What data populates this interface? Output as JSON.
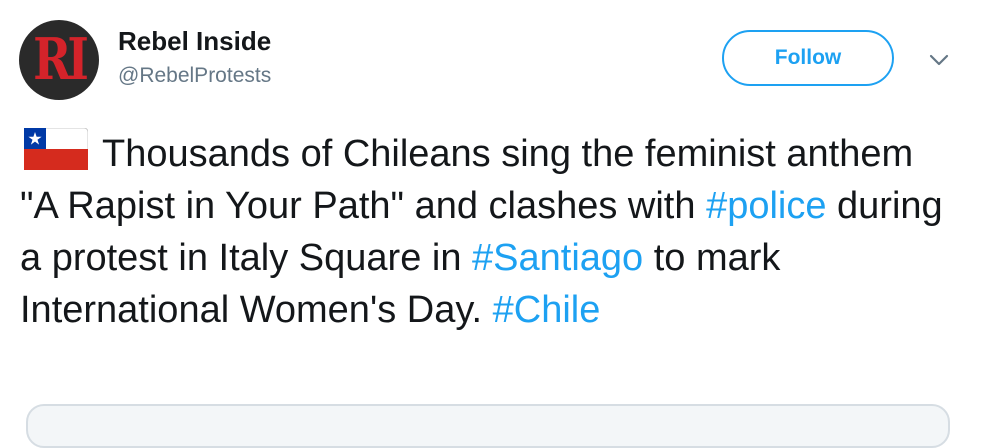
{
  "author": {
    "avatar_logo": "RI",
    "display_name": "Rebel Inside",
    "handle": "@RebelProtests"
  },
  "actions": {
    "follow_label": "Follow",
    "menu_icon": "chevron-down-icon"
  },
  "tweet": {
    "flag_icon": "chile-flag-icon",
    "segments": {
      "s1": "Thousands of Chileans sing the feminist anthem \"A Rapist in Your Path\" and clashes with ",
      "tag1": "#police",
      "s2": " during a protest in Italy Square in ",
      "tag2": "#Santiago",
      "s3": " to mark International Women's Day. ",
      "tag3": "#Chile"
    }
  },
  "colors": {
    "accent": "#1da1f2",
    "text": "#14171a",
    "secondary": "#657786",
    "avatar_bg": "#2a2a2a",
    "avatar_logo": "#d4232a"
  }
}
